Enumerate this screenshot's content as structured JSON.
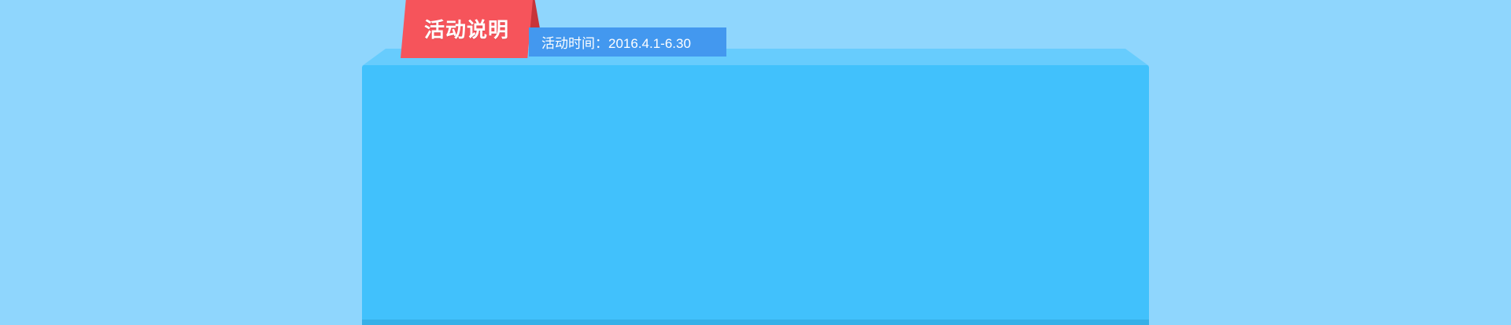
{
  "banner": {
    "title": "活动说明",
    "date_text": "活动时间：2016.4.1-6.30"
  },
  "colors": {
    "background": "#8fd6fd",
    "panel": "#41c1fc",
    "panel_top": "#67ccfd",
    "tab": "#f6545b",
    "date_strip": "#4398ef"
  }
}
